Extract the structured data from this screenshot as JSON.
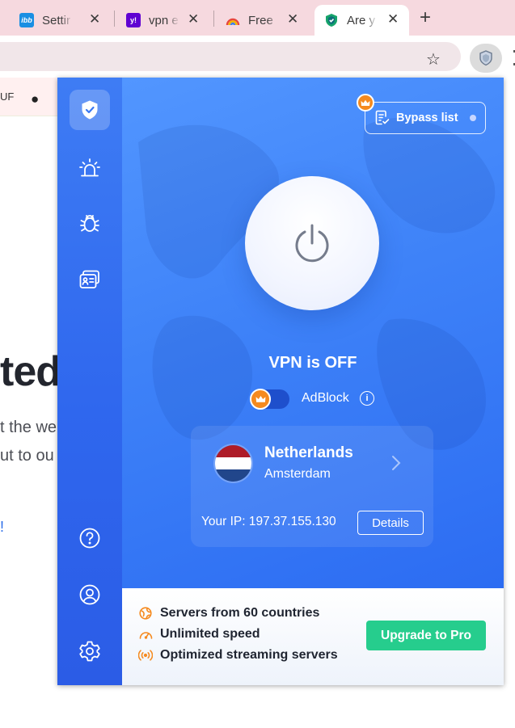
{
  "browser": {
    "tabs": [
      {
        "title": "Settir",
        "favicon": "ibb",
        "favicon_color": "#1a8fe3"
      },
      {
        "title": "vpn e",
        "favicon": "y!",
        "favicon_color": "#6001d2"
      },
      {
        "title": "Free",
        "favicon": "rainbow-icon",
        "favicon_color": "#e8453c"
      },
      {
        "title": "Are y",
        "favicon": "shield-check-icon",
        "favicon_color": "#16a36a"
      }
    ],
    "new_tab_symbol": "+",
    "close_symbol": "✕",
    "bookmark_symbol": "☆"
  },
  "background_page": {
    "strip_text": "UF",
    "heading": "ted",
    "line1": "t the we",
    "line2": "ut to ou",
    "link_text": "!"
  },
  "popup": {
    "bypass_label": "Bypass list",
    "status_text": "VPN is OFF",
    "adblock_label": "AdBlock",
    "adblock_enabled": false,
    "info_symbol": "i",
    "location": {
      "country": "Netherlands",
      "city": "Amsterdam",
      "flag_colors": [
        "#ae1c28",
        "#ffffff",
        "#21468b"
      ]
    },
    "ip_text": "Your IP: 197.37.155.130",
    "details_label": "Details",
    "features": [
      {
        "text": "Servers from 60 countries",
        "icon": "globe-icon"
      },
      {
        "text": "Unlimited speed",
        "icon": "speedometer-icon"
      },
      {
        "text": "Optimized streaming servers",
        "icon": "broadcast-icon"
      }
    ],
    "upgrade_label": "Upgrade to Pro",
    "sidebar": [
      "shield-icon",
      "alarm-icon",
      "bug-icon",
      "id-card-icon",
      "help-icon",
      "account-icon",
      "settings-icon"
    ],
    "colors": {
      "accent_blue": "#3e82f8",
      "premium_orange": "#f58a1f",
      "upgrade_green": "#26cd8d"
    }
  }
}
